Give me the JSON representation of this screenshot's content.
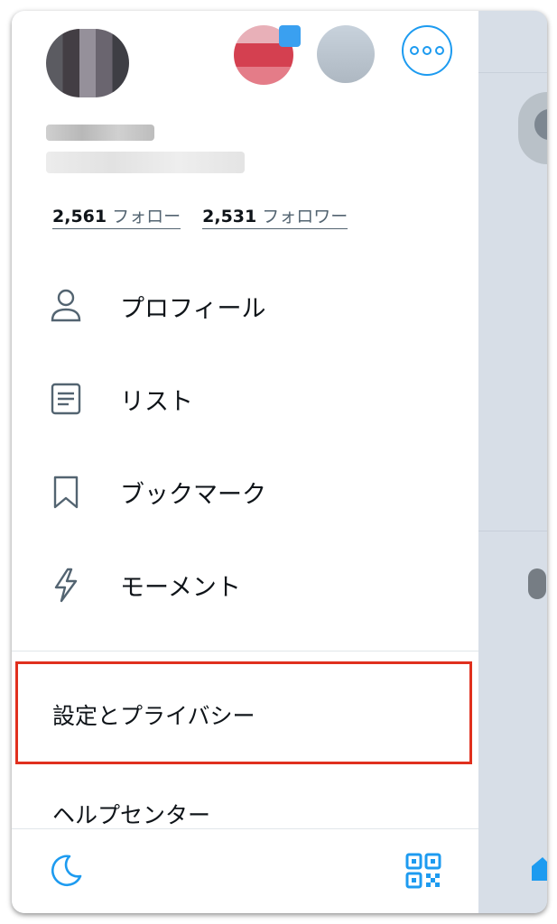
{
  "stats": {
    "following_count": "2,561",
    "following_label": "フォロー",
    "followers_count": "2,531",
    "followers_label": "フォロワー"
  },
  "menu": [
    {
      "label": "プロフィール",
      "icon": "person-icon"
    },
    {
      "label": "リスト",
      "icon": "list-icon"
    },
    {
      "label": "ブックマーク",
      "icon": "bookmark-icon"
    },
    {
      "label": "モーメント",
      "icon": "lightning-icon"
    }
  ],
  "secondary": {
    "settings_label": "設定とプライバシー",
    "help_label": "ヘルプセンター"
  },
  "colors": {
    "accent": "#1d9bf0",
    "highlight": "#e0301e"
  }
}
